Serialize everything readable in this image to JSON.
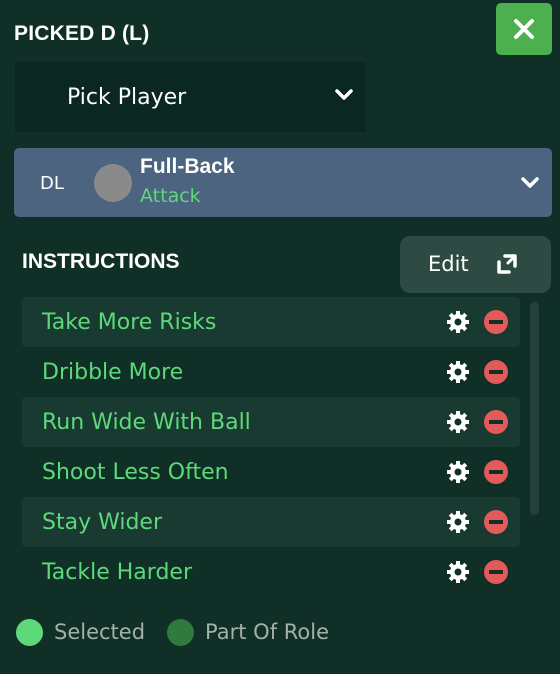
{
  "header": {
    "title": "PICKED D (L)"
  },
  "pick_player": {
    "label": "Pick Player"
  },
  "role": {
    "position": "DL",
    "name": "Full-Back",
    "duty": "Attack"
  },
  "instructions": {
    "title": "INSTRUCTIONS",
    "edit_label": "Edit",
    "items": [
      {
        "label": "Take More Risks"
      },
      {
        "label": "Dribble More"
      },
      {
        "label": "Run Wide With Ball"
      },
      {
        "label": "Shoot Less Often"
      },
      {
        "label": "Stay Wider"
      },
      {
        "label": "Tackle Harder"
      }
    ]
  },
  "legend": {
    "selected": {
      "label": "Selected",
      "color": "#5dd97a"
    },
    "part_of_role": {
      "label": "Part Of Role",
      "color": "#2f7a3c"
    }
  },
  "colors": {
    "background": "#0f2f27",
    "accent_green": "#4caf50",
    "role_bar": "#4c6480",
    "remove_red": "#e35a5a"
  },
  "icons": [
    "close-icon",
    "chevron-down-icon",
    "expand-icon",
    "gear-icon",
    "remove-icon"
  ]
}
